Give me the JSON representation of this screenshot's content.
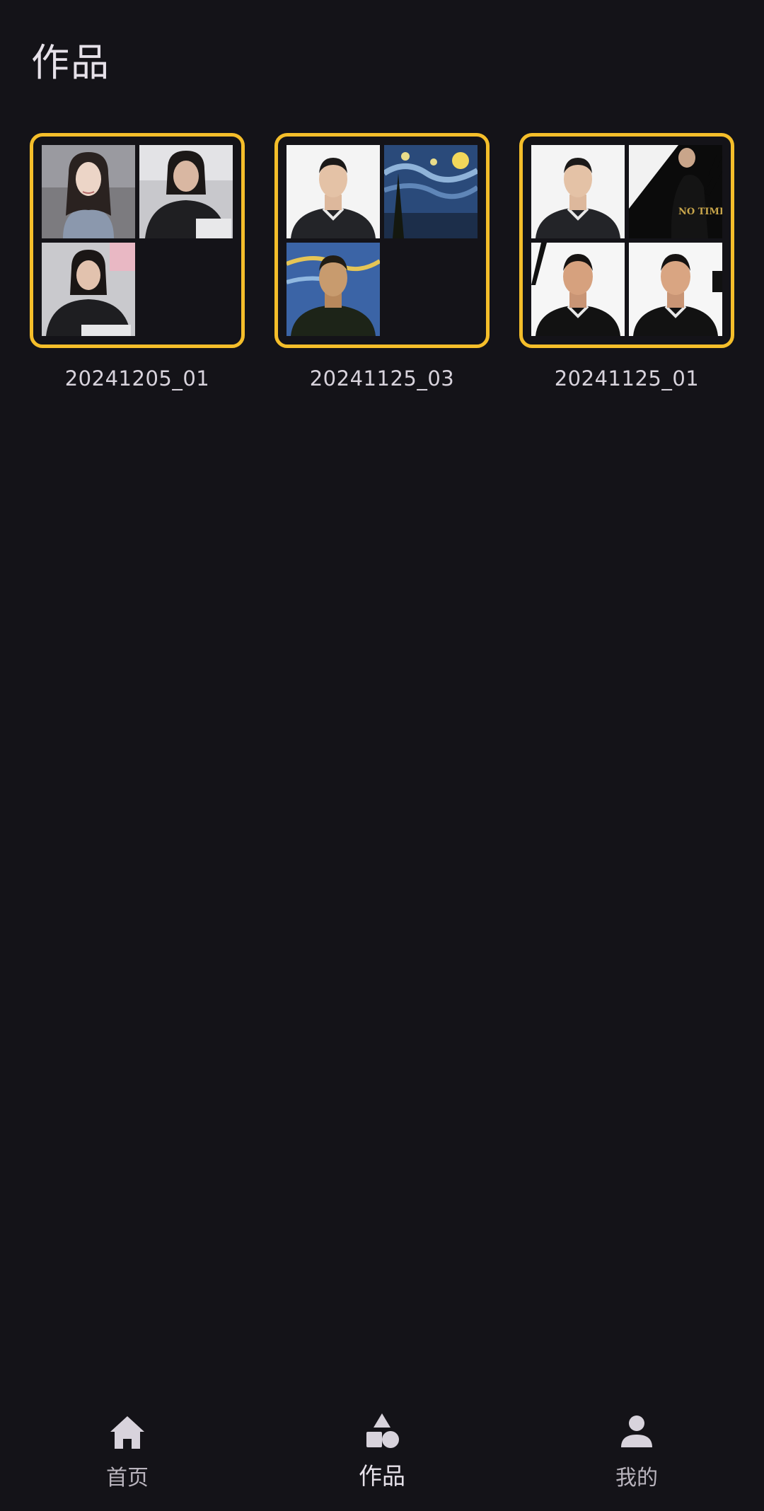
{
  "header": {
    "title": "作品"
  },
  "works": [
    {
      "label": "20241205_01"
    },
    {
      "label": "20241125_03"
    },
    {
      "label": "20241125_01"
    }
  ],
  "bottom_nav": {
    "items": [
      {
        "label": "首页",
        "icon": "home-icon",
        "active": false
      },
      {
        "label": "作品",
        "icon": "shapes-icon",
        "active": true
      },
      {
        "label": "我的",
        "icon": "person-icon",
        "active": false
      }
    ]
  },
  "colors": {
    "background": "#141318",
    "card_border": "#f5be2a",
    "text_primary": "#e6e1e9",
    "text_secondary": "#b9b4bd",
    "nav_icon": "#d8d3dc"
  },
  "thumb_poster_text": "NO TIME TO"
}
